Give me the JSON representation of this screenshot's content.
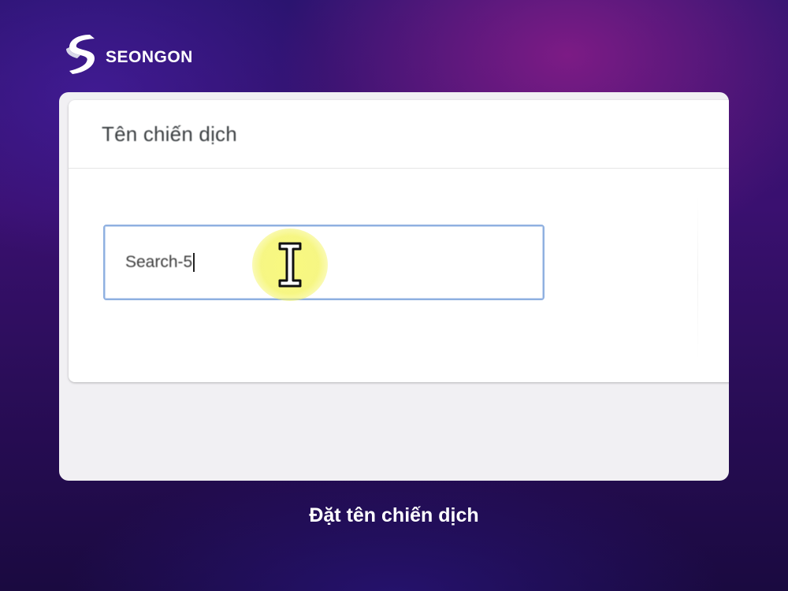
{
  "brand": {
    "logo_icon": "seongon-s-logo-icon",
    "name": "SEONGON"
  },
  "campaign_card": {
    "title": "Tên chiến dịch",
    "name_input": {
      "value": "Search-5",
      "caret_visible": true
    },
    "cursor_icon": "text-cursor-icon",
    "cursor_highlight_color": "#f6f67a"
  },
  "caption": "Đặt tên chiến dịch",
  "colors": {
    "background_primary": "#2b1470",
    "background_accent": "#96228c",
    "input_border_focus": "#8fb0e0"
  }
}
